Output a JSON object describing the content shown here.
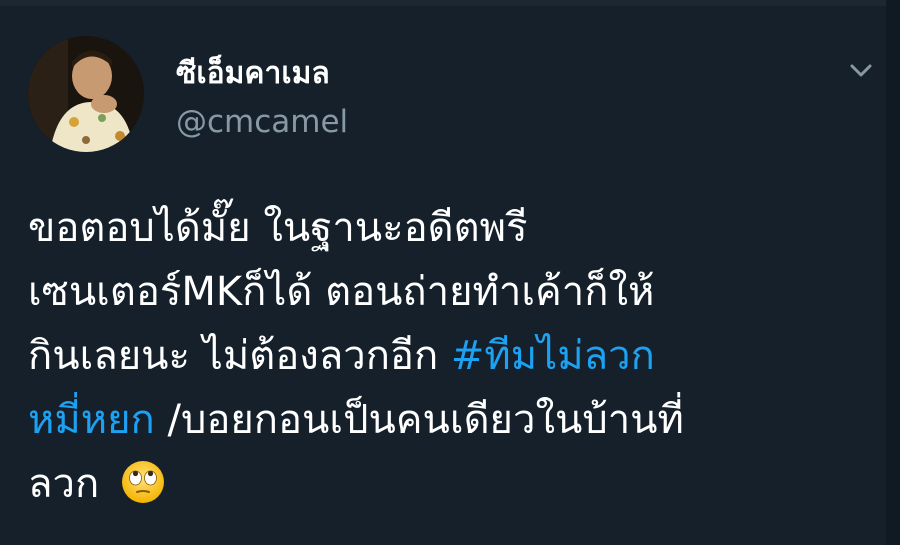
{
  "tweet": {
    "author": {
      "display_name": "ซีเอ็มคาเมล",
      "handle": "@cmcamel"
    },
    "text_lines": [
      [
        "ขอตอบได้มั๊ย ในฐานะอดีตพรี"
      ],
      [
        "เซนเตอร์MKก็ได้ ตอนถ่ายทำเค้าก็ให้"
      ],
      [
        "กินเลยนะ ไม่ต้องลวกอีก "
      ],
      [
        "หมี่หยก",
        " /บอยกอนเป็นคนเดียวในบ้านที่"
      ],
      [
        "ลวก "
      ]
    ],
    "hashtag": {
      "part1": "#ทีมไม่ลวก",
      "part2": "หมี่หยก",
      "color": "#1da1f2"
    },
    "emoji": "face-with-rolling-eyes-emoji",
    "menu_icon": "chevron-down-icon"
  },
  "colors": {
    "background": "#15202b",
    "secondary_text": "#8899a6",
    "accent": "#1da1f2"
  }
}
